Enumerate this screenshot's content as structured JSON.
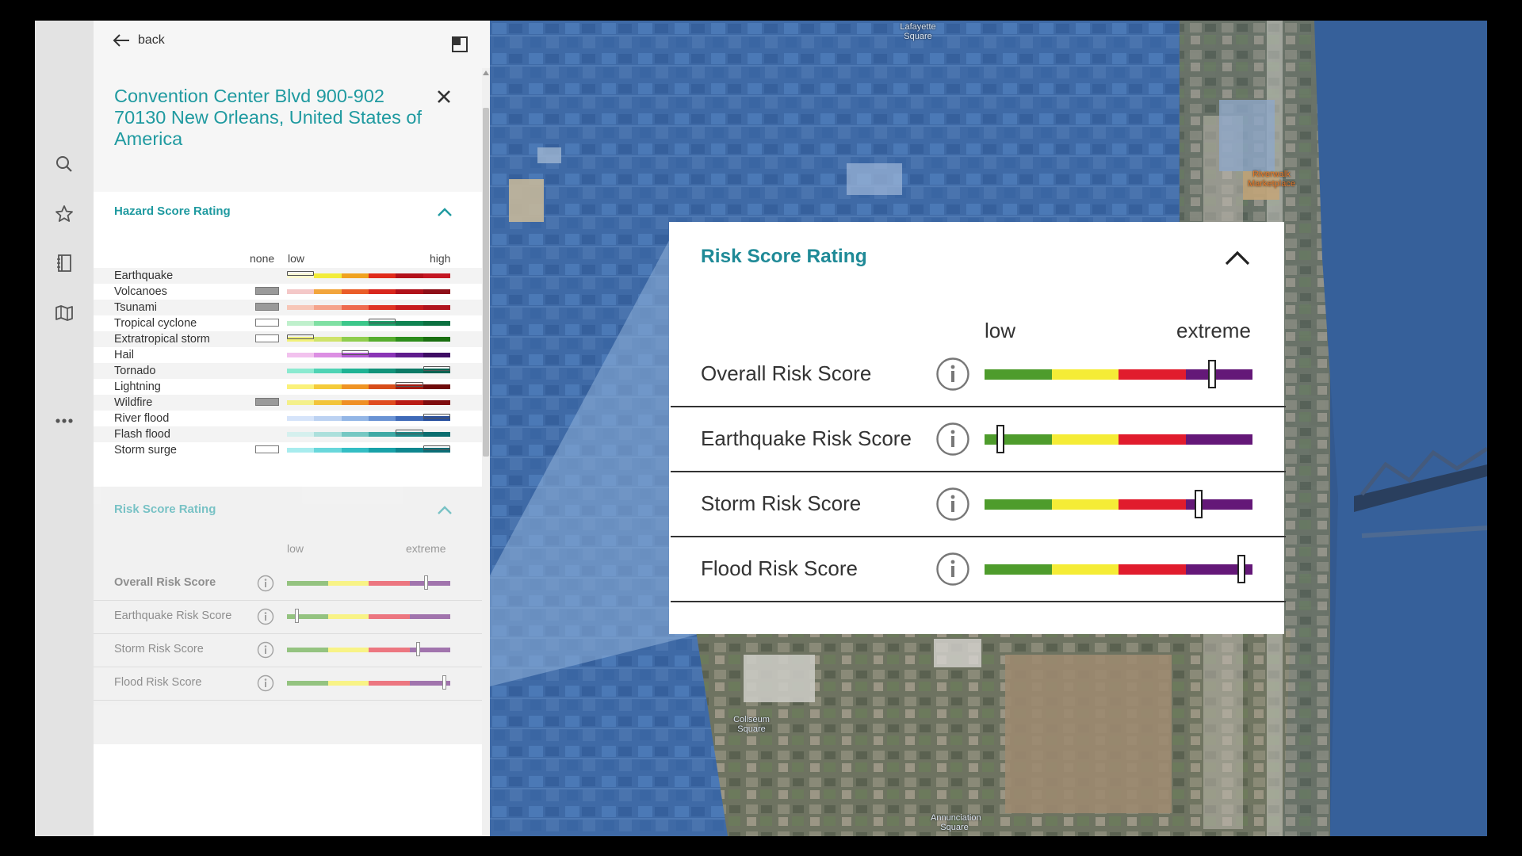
{
  "panel": {
    "back_label": "back",
    "address": "Convention Center Blvd 900-902 70130 New Orleans, United States of America"
  },
  "hazard": {
    "title": "Hazard Score Rating",
    "scale_none": "none",
    "scale_low": "low",
    "scale_high": "high",
    "items": [
      {
        "name": "Earthquake",
        "none_box": false,
        "colors": [
          "#fffbd0",
          "#f2ec3a",
          "#f0a21f",
          "#e02a1a",
          "#b3101a",
          "#c41622"
        ],
        "level": 0
      },
      {
        "name": "Volcanoes",
        "none_box": true,
        "colors": [
          "#f4c8c8",
          "#f2a53c",
          "#ea5d28",
          "#d8261c",
          "#b0111a",
          "#8e0f18"
        ],
        "level": null
      },
      {
        "name": "Tsunami",
        "none_box": true,
        "colors": [
          "#f7c7b8",
          "#f5a48c",
          "#ee6a4e",
          "#df3424",
          "#c71b1e",
          "#b0141e"
        ],
        "level": null
      },
      {
        "name": "Tropical cyclone",
        "none_box": false,
        "colors": [
          "#bff0cc",
          "#7fe0a3",
          "#3cc78a",
          "#1a9f67",
          "#0f8351",
          "#0c7040"
        ],
        "level": 3
      },
      {
        "name": "Extratropical storm",
        "none_box": false,
        "colors": [
          "#f2f27a",
          "#cfe36b",
          "#8fcd4d",
          "#57ad2f",
          "#2d8d1c",
          "#1a6f10"
        ],
        "level": 0
      },
      {
        "name": "Hail",
        "none_box": false,
        "colors": [
          "#f2c2ee",
          "#dc8fe3",
          "#b35bd2",
          "#8a35b6",
          "#5f1c8c",
          "#3e0c63"
        ],
        "level": 2
      },
      {
        "name": "Tornado",
        "none_box": false,
        "colors": [
          "#8bead0",
          "#4fd3b4",
          "#20b394",
          "#12937a",
          "#0c7a66",
          "#0a6352"
        ],
        "level": 5
      },
      {
        "name": "Lightning",
        "none_box": false,
        "colors": [
          "#faf17a",
          "#f4cb3a",
          "#ef9424",
          "#d74d1a",
          "#a31c12",
          "#6f0a0a"
        ],
        "level": 4
      },
      {
        "name": "Wildfire",
        "none_box": true,
        "colors": [
          "#f4f08a",
          "#f2c43a",
          "#ef8f25",
          "#df4b1f",
          "#b81a14",
          "#7e0c0e"
        ],
        "level": null
      },
      {
        "name": "River flood",
        "none_box": false,
        "colors": [
          "#d6e4fa",
          "#bcd2f2",
          "#93b6e6",
          "#6a93d4",
          "#3f6ab8",
          "#274e9f"
        ],
        "level": 5
      },
      {
        "name": "Flash flood",
        "none_box": false,
        "colors": [
          "#d5f0ee",
          "#ace0dc",
          "#76c8c3",
          "#3fa9a5",
          "#1b8a89",
          "#0b6e70"
        ],
        "level": 4
      },
      {
        "name": "Storm surge",
        "none_box": false,
        "colors": [
          "#a8ecee",
          "#69d7db",
          "#34bec4",
          "#18a1a8",
          "#0e868e",
          "#0a6d76"
        ],
        "level": 5
      }
    ]
  },
  "risk": {
    "title": "Risk Score Rating",
    "scale_low": "low",
    "scale_high": "extreme",
    "colors": [
      "#4e9c2c",
      "#f5ec36",
      "#e11c2d",
      "#641878"
    ],
    "items": [
      {
        "name": "Overall Risk Score",
        "level": 0.85
      },
      {
        "name": "Earthquake Risk Score",
        "level": 0.06
      },
      {
        "name": "Storm Risk Score",
        "level": 0.8
      },
      {
        "name": "Flood Risk Score",
        "level": 0.96
      }
    ]
  },
  "map": {
    "labels": [
      "Lafayette Square",
      "Riverwalk Marketplace",
      "Coliseum Square",
      "Annunciation Square"
    ]
  },
  "icons": {
    "back": "arrow-left-icon",
    "expand": "panel-toggle-icon",
    "close": "close-icon",
    "caret": "chevron-up-icon",
    "info": "info-icon",
    "rail": [
      "search-icon",
      "star-icon",
      "book-icon",
      "map-icon",
      "more-icon"
    ]
  }
}
